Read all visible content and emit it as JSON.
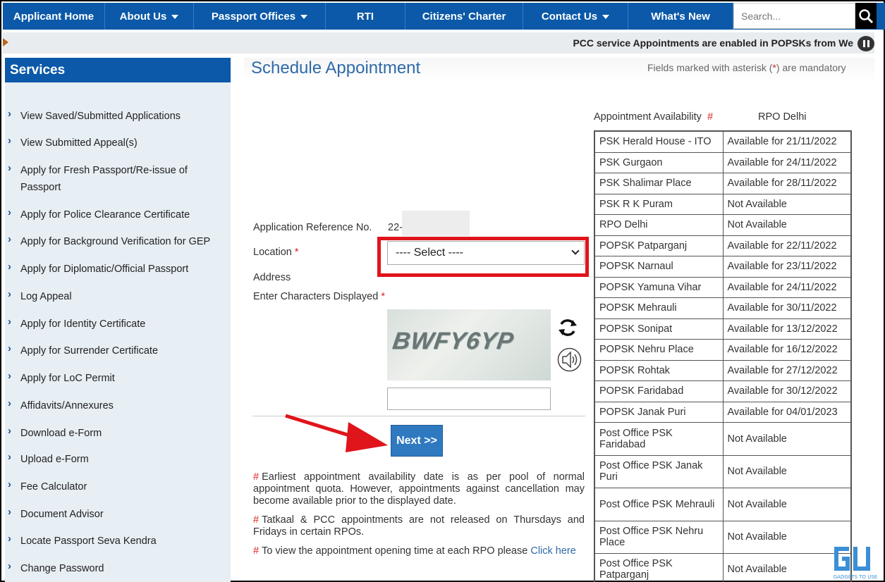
{
  "nav": {
    "items": [
      {
        "label": "Applicant Home",
        "dropdown": false
      },
      {
        "label": "About Us",
        "dropdown": true
      },
      {
        "label": "Passport Offices",
        "dropdown": true
      },
      {
        "label": "RTI",
        "dropdown": false
      },
      {
        "label": "Citizens' Charter",
        "dropdown": false
      },
      {
        "label": "Contact Us",
        "dropdown": true
      },
      {
        "label": "What's New",
        "dropdown": false
      }
    ],
    "search_placeholder": "Search...",
    "search_icon": "search-icon"
  },
  "ticker": {
    "text": "PCC service Appointments are enabled in POPSKs from We"
  },
  "sidebar": {
    "title": "Services",
    "items": [
      {
        "label": "View Saved/Submitted Applications"
      },
      {
        "label": "View Submitted Appeal(s)"
      },
      {
        "label": "Apply for Fresh Passport/Re-issue of Passport"
      },
      {
        "label": "Apply for Police Clearance Certificate"
      },
      {
        "label": "Apply for Background Verification for GEP"
      },
      {
        "label": "Apply for Diplomatic/Official Passport"
      },
      {
        "label": "Log Appeal"
      },
      {
        "label": "Apply for Identity Certificate"
      },
      {
        "label": "Apply for Surrender Certificate"
      },
      {
        "label": "Apply for LoC Permit"
      },
      {
        "label": "Affidavits/Annexures"
      },
      {
        "label": "Download e-Form"
      },
      {
        "label": "Upload e-Form"
      },
      {
        "label": "Fee Calculator"
      },
      {
        "label": "Document Advisor"
      },
      {
        "label": "Locate Passport Seva Kendra"
      },
      {
        "label": "Change Password"
      }
    ]
  },
  "main": {
    "title": "Schedule Appointment",
    "mandatory_note_before": "Fields marked with asterisk (",
    "mandatory_star": "*",
    "mandatory_note_after": ") are mandatory",
    "form": {
      "ref_label": "Application Reference No.",
      "ref_value": "22-",
      "location_label": "Location",
      "location_value": "---- Select ----",
      "address_label": "Address",
      "captcha_label": "Enter Characters Displayed",
      "captcha_text": "BWFY6YP",
      "captcha_input": "",
      "required_mark": "*"
    },
    "next_button": "Next >>",
    "notes": [
      {
        "hash": "#",
        "text": "Earliest appointment availability date is as per pool of normal appointment quota. However, appointments against cancellation may become available prior to the displayed date."
      },
      {
        "hash": "#",
        "text": "Tatkaal & PCC appointments are not released on Thursdays and Fridays in certain RPOs."
      },
      {
        "hash": "#",
        "text": "To view the appointment opening time at each RPO please ",
        "link": "Click here"
      }
    ]
  },
  "availability": {
    "label": "Appointment Availability",
    "hash": "#",
    "rpo": "RPO Delhi",
    "rows": [
      {
        "psk": "PSK Herald House - ITO",
        "status": "Available for 21/11/2022"
      },
      {
        "psk": "PSK Gurgaon",
        "status": "Available for 24/11/2022"
      },
      {
        "psk": "PSK Shalimar Place",
        "status": "Available for 28/11/2022"
      },
      {
        "psk": "PSK R K Puram",
        "status": "Not Available"
      },
      {
        "psk": "RPO Delhi",
        "status": "Not Available"
      },
      {
        "psk": "POPSK Patparganj",
        "status": "Available for 22/11/2022"
      },
      {
        "psk": "POPSK Narnaul",
        "status": "Available for 23/11/2022"
      },
      {
        "psk": "POPSK Yamuna Vihar",
        "status": "Available for 24/11/2022"
      },
      {
        "psk": "POPSK Mehrauli",
        "status": "Available for 30/11/2022"
      },
      {
        "psk": "POPSK Sonipat",
        "status": "Available for 13/12/2022"
      },
      {
        "psk": "POPSK Nehru Place",
        "status": "Available for 16/12/2022"
      },
      {
        "psk": "POPSK Rohtak",
        "status": "Available for 27/12/2022"
      },
      {
        "psk": "POPSK Faridabad",
        "status": "Available for 30/12/2022"
      },
      {
        "psk": "POPSK Janak Puri",
        "status": "Available for 04/01/2023"
      },
      {
        "psk": "Post Office PSK Faridabad",
        "status": "Not Available"
      },
      {
        "psk": "Post Office PSK Janak Puri",
        "status": "Not Available"
      },
      {
        "psk": "Post Office PSK Mehrauli",
        "status": "Not Available"
      },
      {
        "psk": "Post Office PSK Nehru Place",
        "status": "Not Available"
      },
      {
        "psk": "Post Office PSK Patparganj",
        "status": "Not Available"
      }
    ]
  },
  "watermark": {
    "text": "GADGETS TO USE"
  },
  "colors": {
    "nav_blue": "#0b59a8",
    "highlight_red": "#e0141b",
    "title_blue": "#2e6aa8"
  }
}
